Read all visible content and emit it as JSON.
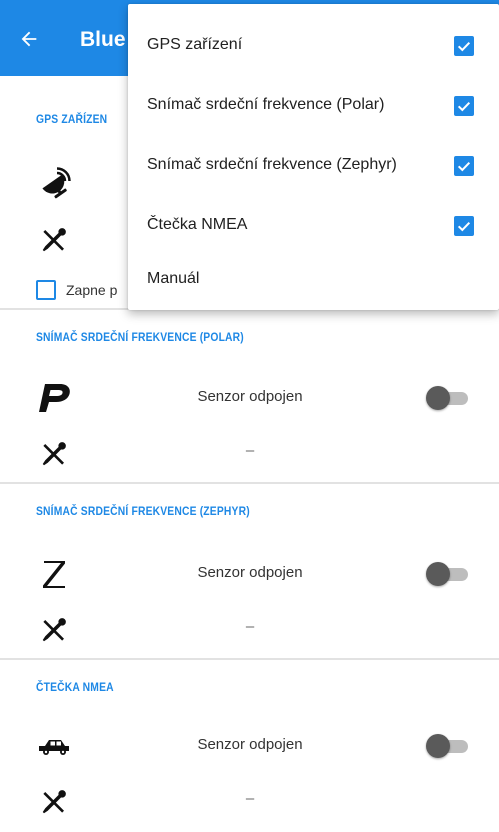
{
  "appbar": {
    "title": "Blue"
  },
  "sections": {
    "gps": {
      "title": "GPS ZAŘÍZEN",
      "checkbox_label": "Zapne p"
    },
    "polar": {
      "title": "SNÍMAČ SRDEČNÍ FREKVENCE (POLAR)",
      "status": "Senzor odpojen",
      "value": "–"
    },
    "zephyr": {
      "title": "SNÍMAČ SRDEČNÍ FREKVENCE (ZEPHYR)",
      "status": "Senzor odpojen",
      "value": "–"
    },
    "nmea": {
      "title": "ČTEČKA NMEA",
      "status": "Senzor odpojen",
      "value": "–"
    }
  },
  "menu": {
    "items": [
      {
        "label": "GPS zařízení",
        "checked": true
      },
      {
        "label": "Snímač srdeční frekvence (Polar)",
        "checked": true
      },
      {
        "label": "Snímač srdeční frekvence (Zephyr)",
        "checked": true
      },
      {
        "label": "Čtečka NMEA",
        "checked": true
      },
      {
        "label": "Manuál",
        "checked": false
      }
    ]
  },
  "icons": {
    "back": "arrow-left-icon",
    "gps": "satellite-dish-icon",
    "settings": "tools-icon",
    "polar": "polar-logo-icon",
    "zephyr": "zephyr-z-icon",
    "nmea": "car-icon",
    "check": "checkmark-icon"
  },
  "colors": {
    "primary": "#1e88e5",
    "switch_track": "#bdbdbd",
    "switch_thumb": "#5a5a5a"
  }
}
